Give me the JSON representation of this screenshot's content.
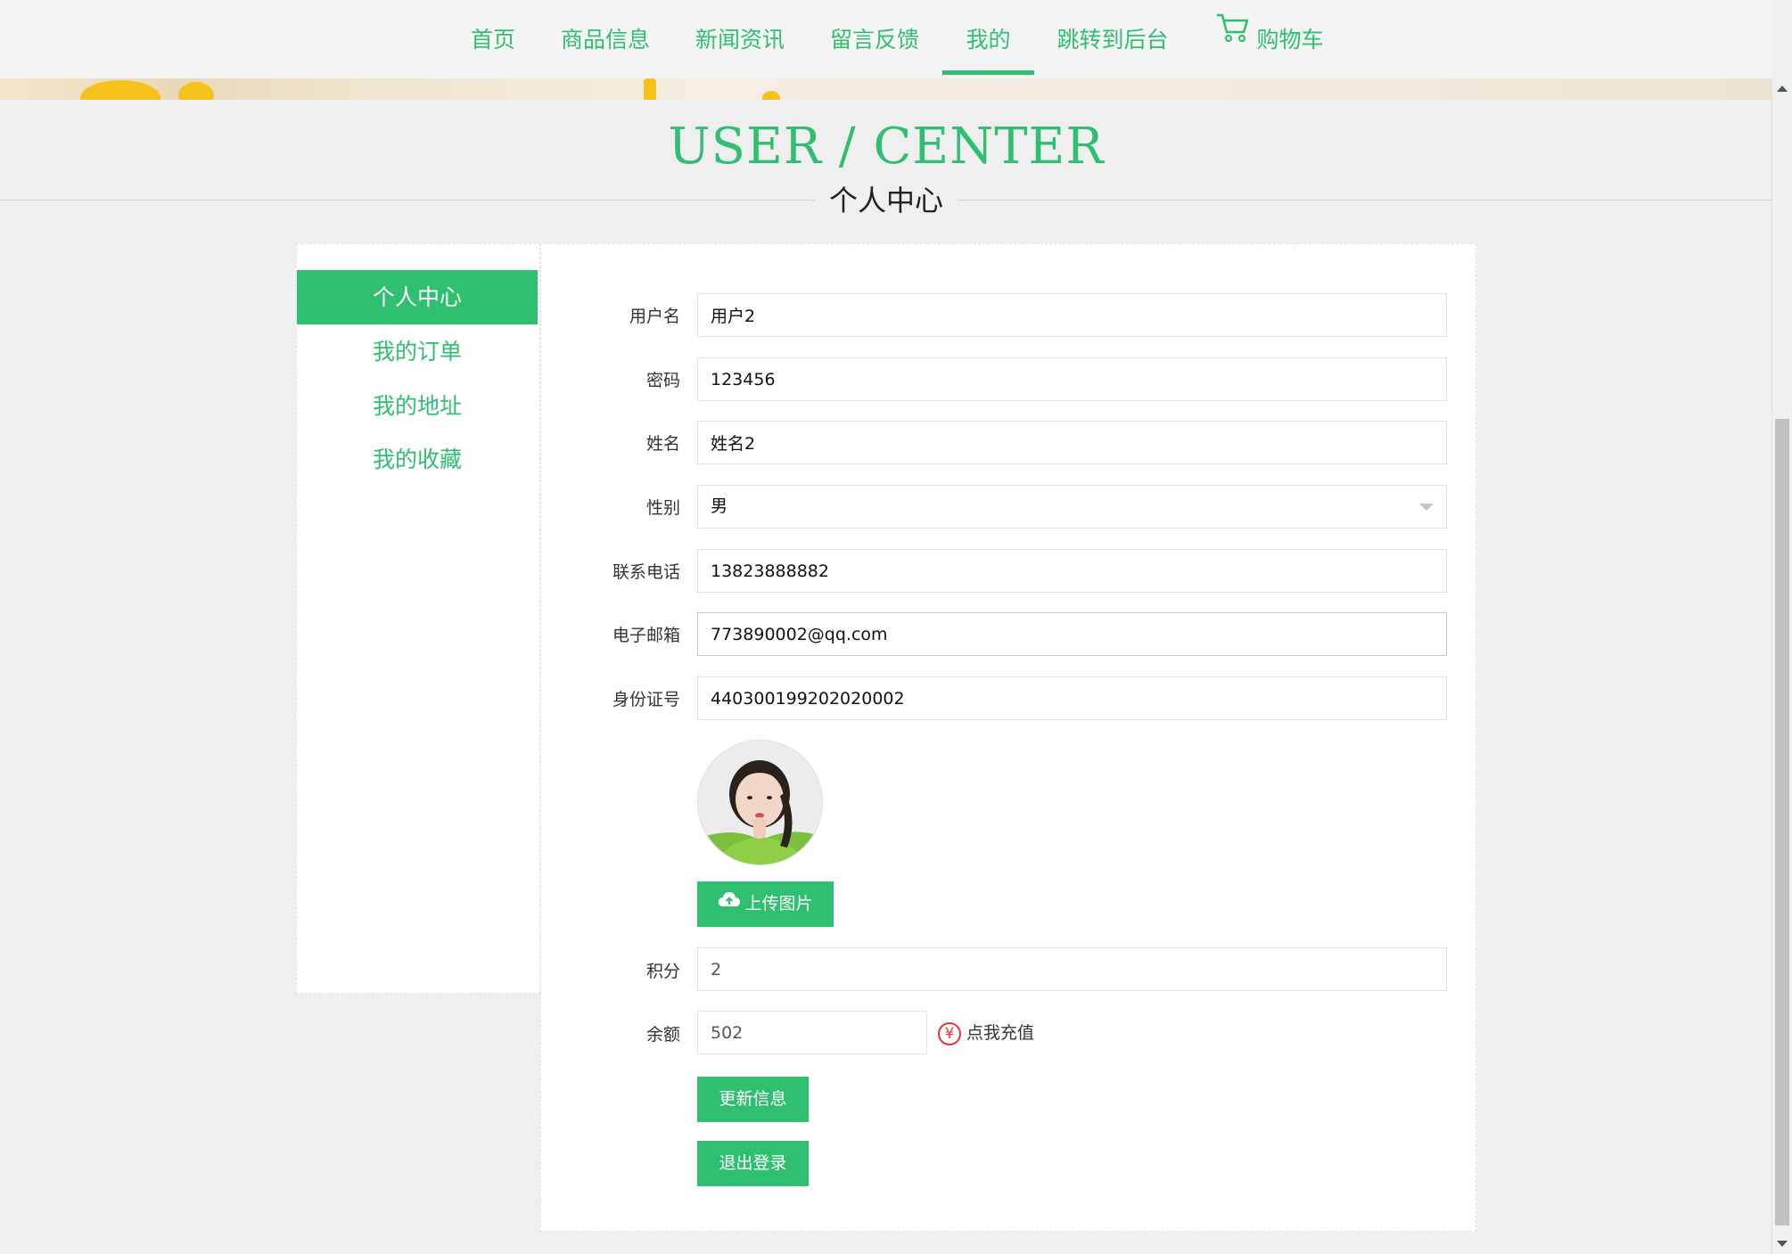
{
  "nav": {
    "items": [
      "首页",
      "商品信息",
      "新闻资讯",
      "留言反馈",
      "我的",
      "跳转到后台"
    ],
    "active_index": 4,
    "cart_label": "购物车"
  },
  "header": {
    "title_en": "USER / CENTER",
    "title_cn": "个人中心"
  },
  "sidebar": {
    "items": [
      "个人中心",
      "我的订单",
      "我的地址",
      "我的收藏"
    ],
    "active_index": 0
  },
  "form": {
    "username": {
      "label": "用户名",
      "value": "用户2"
    },
    "password": {
      "label": "密码",
      "value": "123456"
    },
    "name": {
      "label": "姓名",
      "value": "姓名2"
    },
    "gender": {
      "label": "性别",
      "value": "男"
    },
    "phone": {
      "label": "联系电话",
      "value": "13823888882"
    },
    "email": {
      "label": "电子邮箱",
      "value": "773890002@qq.com"
    },
    "idcard": {
      "label": "身份证号",
      "value": "440300199202020002"
    },
    "upload_label": "上传图片",
    "points": {
      "label": "积分",
      "value": "2"
    },
    "balance": {
      "label": "余额",
      "value": "502"
    },
    "recharge_label": "点我充值",
    "update_label": "更新信息",
    "logout_label": "退出登录"
  },
  "colors": {
    "accent": "#2fbf71",
    "background": "#efefef",
    "recharge_icon": "#e33333"
  },
  "icons": [
    "cart-icon",
    "cloud-upload-icon",
    "yen-icon",
    "chevron-down-icon"
  ]
}
